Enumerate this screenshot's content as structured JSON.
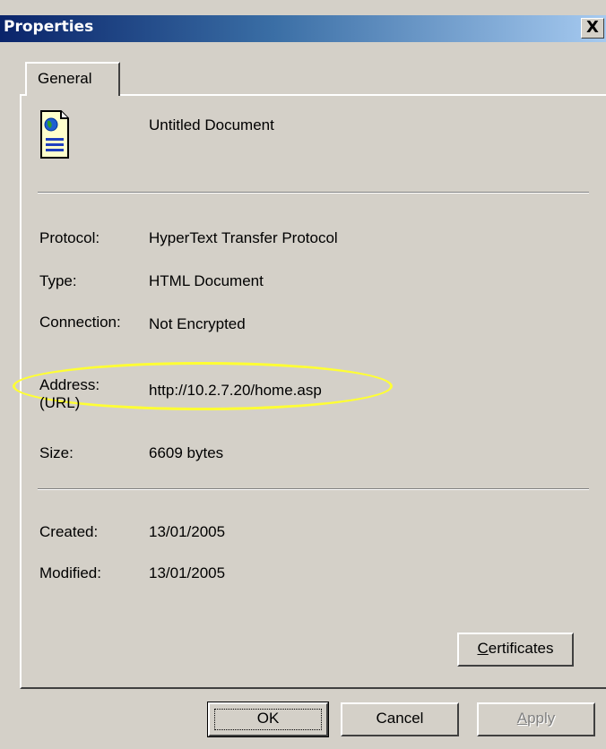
{
  "window": {
    "title": "Properties",
    "close_label": "X"
  },
  "tabs": [
    {
      "label": "General"
    }
  ],
  "document": {
    "name": "Untitled Document",
    "icon": "html-document-icon"
  },
  "fields": {
    "protocol": {
      "label": "Protocol:",
      "value": "HyperText Transfer Protocol"
    },
    "type": {
      "label": "Type:",
      "value": "HTML Document"
    },
    "connection": {
      "label": "Connection:",
      "value": "Not Encrypted"
    },
    "address": {
      "label_line1": "Address:",
      "label_line2": "(URL)",
      "value": "http://10.2.7.20/home.asp"
    },
    "size": {
      "label": "Size:",
      "value": "6609 bytes"
    },
    "created": {
      "label": "Created:",
      "value": "13/01/2005"
    },
    "modified": {
      "label": "Modified:",
      "value": "13/01/2005"
    }
  },
  "buttons": {
    "certificates": {
      "mnemonic": "C",
      "rest": "ertificates"
    },
    "ok": "OK",
    "cancel": "Cancel",
    "apply": {
      "mnemonic": "A",
      "rest": "pply",
      "disabled": true
    }
  },
  "colors": {
    "face": "#d4d0c8",
    "title_gradient_start": "#0a246a",
    "title_gradient_end": "#a6caf0",
    "highlight": "#ffff33"
  }
}
